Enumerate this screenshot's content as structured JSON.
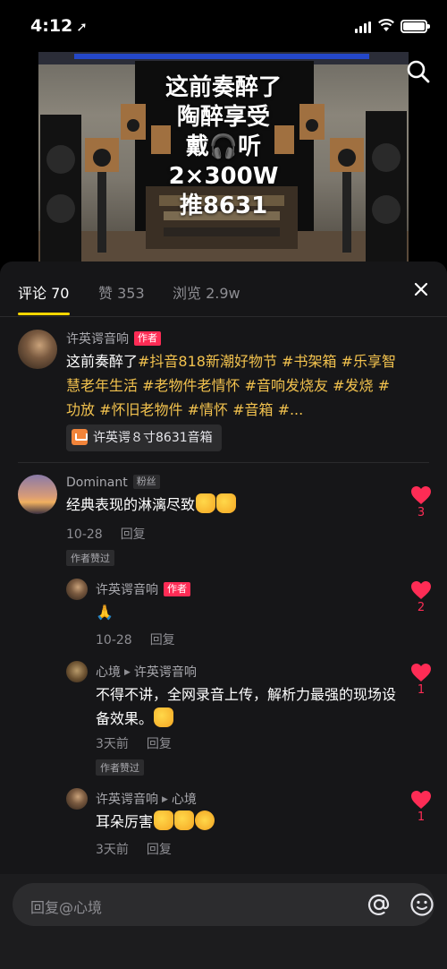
{
  "status_bar": {
    "time": "4:12"
  },
  "video": {
    "caption_lines": [
      "这前奏醉了",
      "陶醉享受",
      "戴🎧听",
      "2×300W",
      "推8631"
    ]
  },
  "tabs": [
    {
      "label": "评论 70",
      "active": true
    },
    {
      "label": "赞 353",
      "active": false
    },
    {
      "label": "浏览 2.9w",
      "active": false
    }
  ],
  "post": {
    "author": "许英谔音响",
    "author_badge": "作者",
    "text_plain": "这前奏醉了",
    "text_tags": "#抖音818新潮好物节 #书架箱 #乐享智慧老年生活 #老物件老情怀 #音响发烧友 #发烧 #功放 #怀旧老物件 #情怀 #音箱 #...",
    "product_label": "许英谔８寸8631音箱"
  },
  "comments": [
    {
      "user": "Dominant",
      "badge": "粉丝",
      "text": "经典表现的淋漓尽致",
      "date": "10-28",
      "reply_label": "回复",
      "liked_by_author": "作者赞过",
      "likes": "3"
    },
    {
      "user": "许英谔音响",
      "badge": "作者",
      "text": "🙏",
      "date": "10-28",
      "reply_label": "回复",
      "likes": "2"
    },
    {
      "user": "心境",
      "reply_to": "许英谔音响",
      "text": "不得不讲，全网录音上传，解析力最强的现场设备效果。",
      "date": "3天前",
      "reply_label": "回复",
      "liked_by_author": "作者赞过",
      "likes": "1"
    },
    {
      "user": "许英谔音响",
      "reply_to": "心境",
      "text": "耳朵厉害",
      "date": "3天前",
      "reply_label": "回复",
      "likes": "1"
    }
  ],
  "input": {
    "placeholder": "回复@心境"
  },
  "colors": {
    "accent": "#ffd600",
    "like": "#fe2c55",
    "tag": "#f2c24e",
    "sheet": "#161618"
  },
  "icons": [
    "location-arrow-icon",
    "signal-icon",
    "wifi-icon",
    "battery-icon",
    "search-icon",
    "close-icon",
    "heart-icon",
    "cart-icon",
    "at-icon",
    "emoji-icon"
  ]
}
